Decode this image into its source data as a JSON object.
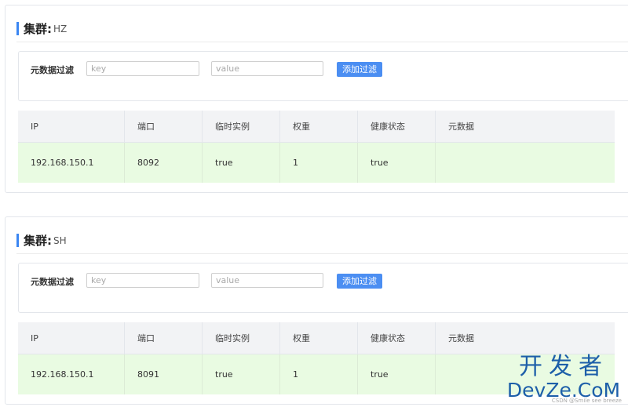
{
  "clusters": [
    {
      "title_label": "集群:",
      "name": "HZ",
      "filter": {
        "label": "元数据过滤",
        "key_placeholder": "key",
        "value_placeholder": "value",
        "add_button_label": "添加过滤"
      },
      "table": {
        "columns": [
          "IP",
          "端口",
          "临时实例",
          "权重",
          "健康状态",
          "元数据"
        ],
        "rows": [
          [
            "192.168.150.1",
            "8092",
            "true",
            "1",
            "true",
            ""
          ]
        ]
      }
    },
    {
      "title_label": "集群:",
      "name": "SH",
      "filter": {
        "label": "元数据过滤",
        "key_placeholder": "key",
        "value_placeholder": "value",
        "add_button_label": "添加过滤"
      },
      "table": {
        "columns": [
          "IP",
          "端口",
          "临时实例",
          "权重",
          "健康状态",
          "元数据"
        ],
        "rows": [
          [
            "192.168.150.1",
            "8091",
            "true",
            "1",
            "true",
            ""
          ]
        ]
      }
    }
  ],
  "watermark": {
    "line1": "开发者",
    "line2": "DevZe.CoM"
  },
  "credit": "CSDN @Smile see breeze",
  "colors": {
    "accent": "#3b86f2",
    "button": "#4b8ef2",
    "healthy_row": "#e9fbe2",
    "header_bg": "#f2f3f5"
  }
}
